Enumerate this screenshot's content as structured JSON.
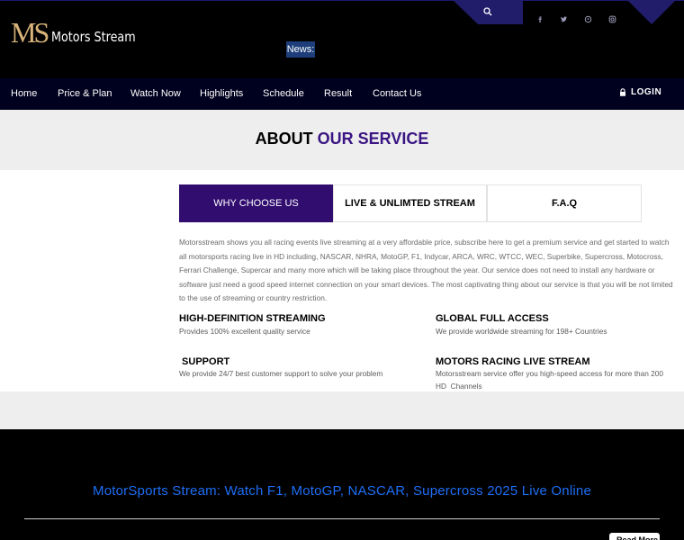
{
  "header": {
    "logo_mark": "MS",
    "logo_text": "Motors Stream",
    "news_label": "News:",
    "social_icons": [
      "facebook-icon",
      "twitter-icon",
      "pinterest-icon",
      "instagram-icon"
    ]
  },
  "nav": {
    "items": [
      {
        "label": "Home"
      },
      {
        "label": "Price & Plan"
      },
      {
        "label": "Watch Now"
      },
      {
        "label": "Highlights"
      },
      {
        "label": "Schedule"
      },
      {
        "label": "Result"
      },
      {
        "label": "Contact Us"
      }
    ],
    "login_label": "LOGIN"
  },
  "about": {
    "title_prefix": "ABOUT",
    "title_accent": "OUR SERVICE"
  },
  "tabs": [
    {
      "label": "WHY CHOOSE US",
      "active": true
    },
    {
      "label": "LIVE & UNLIMTED STREAM",
      "active": false
    },
    {
      "label": "F.A.Q",
      "active": false
    }
  ],
  "description": "Motorsstream shows you all racing events live streaming at a very affordable price, subscribe here to get a premium service and get started to watch all motorsports racing live in HD including, NASCAR, NHRA, MotoGP, F1, Indycar, ARCA, WRC, WTCC, WEC, Superbike, Supercross, Motocross, Ferrari Challenge, Supercar and many more which will be taking place throughout the year. Our service does not need to install any hardware or software just need a good speed internet connection on your smart devices. The most captivating thing about our service is that you will be not limited to the use of streaming or country restriction.",
  "features": [
    {
      "title": "HIGH-DEFINITION STREAMING",
      "text": "Provides 100% excellent quality service"
    },
    {
      "title": "GLOBAL FULL ACCESS",
      "text": "We provide worldwide streaming for 198+ Countries"
    },
    {
      "title": " SUPPORT",
      "text": "We provide 24/7 best customer support to solve your problem"
    },
    {
      "title": "MOTORS RACING LIVE STREAM",
      "text": "Motorsstream service offer you high-speed access for more than 200 HD  Channels"
    }
  ],
  "footer": {
    "title": "MotorSports Stream: Watch F1, MotoGP, NASCAR, Supercross 2025 Live Online",
    "button_label": "Read More"
  },
  "colors": {
    "accent_purple": "#300d6f",
    "nav_bg": "#00001f",
    "footer_link_blue": "#1e6ef5"
  }
}
